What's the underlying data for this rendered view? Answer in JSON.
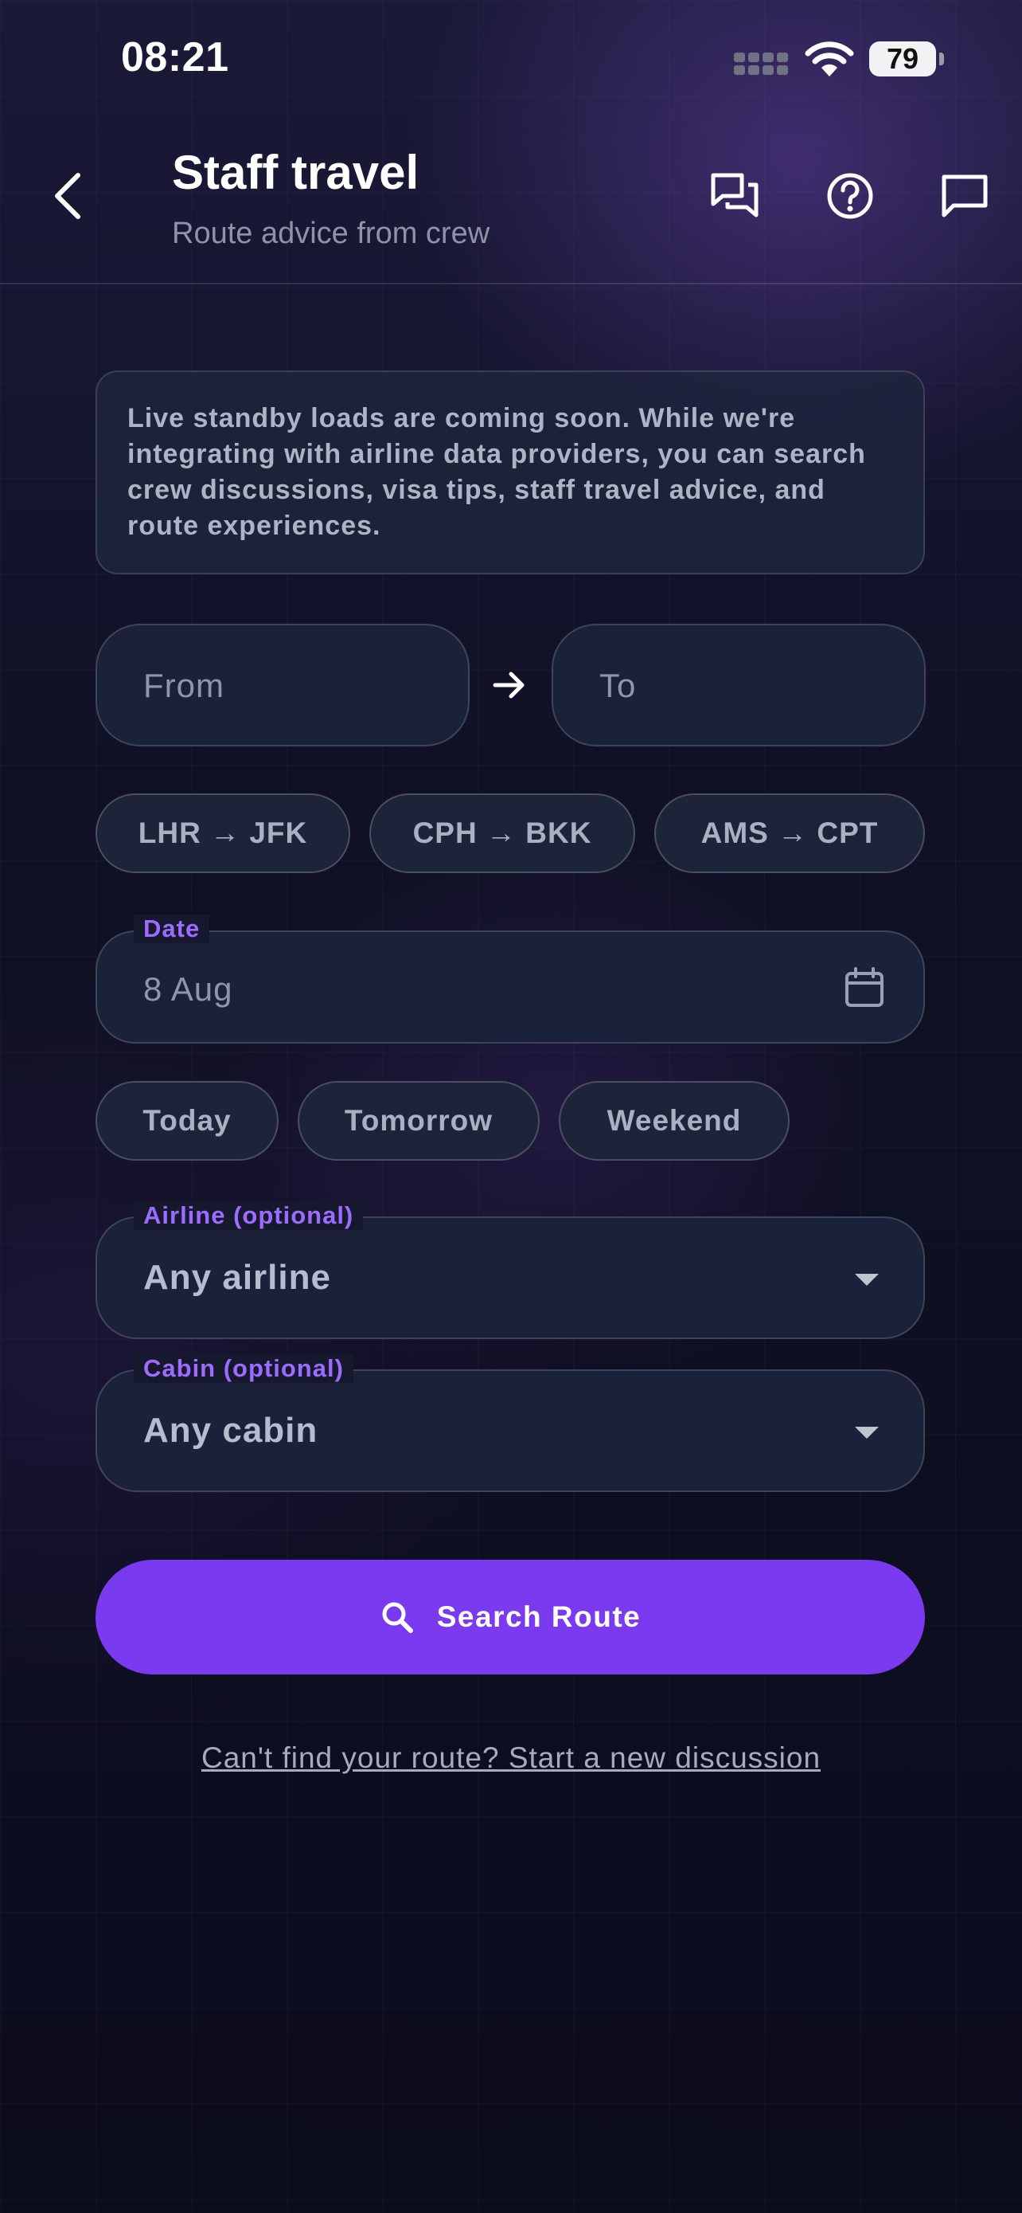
{
  "status_bar": {
    "time": "08:21",
    "battery": "79"
  },
  "header": {
    "title": "Staff travel",
    "subtitle": "Route advice from crew",
    "icons": [
      "back-icon",
      "forum-icon",
      "help-icon",
      "chat-icon"
    ]
  },
  "info_text": "Live standby loads are coming soon. While we're integrating with airline data providers, you can search crew discussions, visa tips, staff travel advice, and route experiences.",
  "route": {
    "from_placeholder": "From",
    "to_placeholder": "To"
  },
  "route_chips": [
    "LHR → JFK",
    "CPH → BKK",
    "AMS → CPT"
  ],
  "date": {
    "label": "Date",
    "value": "8 Aug"
  },
  "date_chips": [
    "Today",
    "Tomorrow",
    "Weekend"
  ],
  "airline": {
    "label": "Airline (optional)",
    "value": "Any airline"
  },
  "cabin": {
    "label": "Cabin (optional)",
    "value": "Any cabin"
  },
  "search_button": "Search Route",
  "new_discussion_link": "Can't find your route? Start a new discussion",
  "colors": {
    "accent": "#7a3af0",
    "label": "#9c6bff",
    "background": "#0d0f20"
  }
}
